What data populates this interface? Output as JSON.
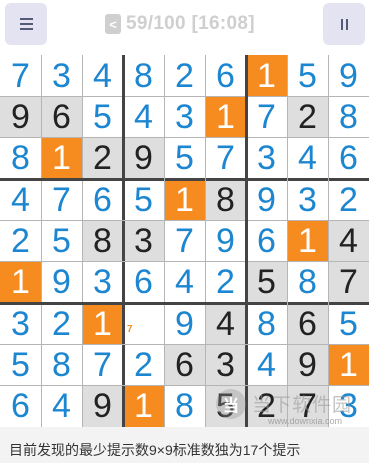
{
  "header": {
    "menu_icon": "hamburger-menu-icon",
    "back_label": "<",
    "progress_time": "59/100 [16:08]",
    "pause_icon": "pause-icon"
  },
  "colors": {
    "user_digit": "#1c86d0",
    "given_digit": "#222222",
    "given_background": "#dedede",
    "hint_background": "#f68b1f"
  },
  "board": {
    "size": 9,
    "cell_types": "u=user-entered (blue), g=given clue (grey cell), h=hint (orange cell), n=empty cell with pencil note",
    "rows": [
      [
        {
          "v": "7",
          "t": "u"
        },
        {
          "v": "3",
          "t": "u"
        },
        {
          "v": "4",
          "t": "u"
        },
        {
          "v": "8",
          "t": "u"
        },
        {
          "v": "2",
          "t": "u"
        },
        {
          "v": "6",
          "t": "u"
        },
        {
          "v": "1",
          "t": "h"
        },
        {
          "v": "5",
          "t": "u"
        },
        {
          "v": "9",
          "t": "u"
        }
      ],
      [
        {
          "v": "9",
          "t": "g"
        },
        {
          "v": "6",
          "t": "g"
        },
        {
          "v": "5",
          "t": "u"
        },
        {
          "v": "4",
          "t": "u"
        },
        {
          "v": "3",
          "t": "u"
        },
        {
          "v": "1",
          "t": "h"
        },
        {
          "v": "7",
          "t": "u"
        },
        {
          "v": "2",
          "t": "g"
        },
        {
          "v": "8",
          "t": "u"
        }
      ],
      [
        {
          "v": "8",
          "t": "u"
        },
        {
          "v": "1",
          "t": "h"
        },
        {
          "v": "2",
          "t": "g"
        },
        {
          "v": "9",
          "t": "g"
        },
        {
          "v": "5",
          "t": "u"
        },
        {
          "v": "7",
          "t": "u"
        },
        {
          "v": "3",
          "t": "u"
        },
        {
          "v": "4",
          "t": "u"
        },
        {
          "v": "6",
          "t": "u"
        }
      ],
      [
        {
          "v": "4",
          "t": "u"
        },
        {
          "v": "7",
          "t": "u"
        },
        {
          "v": "6",
          "t": "u"
        },
        {
          "v": "5",
          "t": "u"
        },
        {
          "v": "1",
          "t": "h"
        },
        {
          "v": "8",
          "t": "g"
        },
        {
          "v": "9",
          "t": "u"
        },
        {
          "v": "3",
          "t": "u"
        },
        {
          "v": "2",
          "t": "u"
        }
      ],
      [
        {
          "v": "2",
          "t": "u"
        },
        {
          "v": "5",
          "t": "u"
        },
        {
          "v": "8",
          "t": "g"
        },
        {
          "v": "3",
          "t": "g"
        },
        {
          "v": "7",
          "t": "u"
        },
        {
          "v": "9",
          "t": "u"
        },
        {
          "v": "6",
          "t": "u"
        },
        {
          "v": "1",
          "t": "h"
        },
        {
          "v": "4",
          "t": "g"
        }
      ],
      [
        {
          "v": "1",
          "t": "h"
        },
        {
          "v": "9",
          "t": "u"
        },
        {
          "v": "3",
          "t": "u"
        },
        {
          "v": "6",
          "t": "u"
        },
        {
          "v": "4",
          "t": "u"
        },
        {
          "v": "2",
          "t": "u"
        },
        {
          "v": "5",
          "t": "g"
        },
        {
          "v": "8",
          "t": "u"
        },
        {
          "v": "7",
          "t": "g"
        }
      ],
      [
        {
          "v": "3",
          "t": "u"
        },
        {
          "v": "2",
          "t": "u"
        },
        {
          "v": "1",
          "t": "h"
        },
        {
          "v": "7",
          "t": "n"
        },
        {
          "v": "9",
          "t": "u"
        },
        {
          "v": "4",
          "t": "g"
        },
        {
          "v": "8",
          "t": "u"
        },
        {
          "v": "6",
          "t": "g"
        },
        {
          "v": "5",
          "t": "u"
        }
      ],
      [
        {
          "v": "5",
          "t": "u"
        },
        {
          "v": "8",
          "t": "u"
        },
        {
          "v": "7",
          "t": "u"
        },
        {
          "v": "2",
          "t": "u"
        },
        {
          "v": "6",
          "t": "g"
        },
        {
          "v": "3",
          "t": "g"
        },
        {
          "v": "4",
          "t": "u"
        },
        {
          "v": "9",
          "t": "g"
        },
        {
          "v": "1",
          "t": "h"
        }
      ],
      [
        {
          "v": "6",
          "t": "u"
        },
        {
          "v": "4",
          "t": "u"
        },
        {
          "v": "9",
          "t": "g"
        },
        {
          "v": "1",
          "t": "h"
        },
        {
          "v": "8",
          "t": "u"
        },
        {
          "v": "5",
          "t": "g"
        },
        {
          "v": "2",
          "t": "g"
        },
        {
          "v": "7",
          "t": "g"
        },
        {
          "v": "3",
          "t": "u"
        }
      ]
    ]
  },
  "footer": {
    "caption": "目前发现的最少提示数9×9标准数独为17个提示"
  },
  "watermark": {
    "logo_text": "当",
    "name": "当下软件园",
    "url": "www.downxia.com"
  }
}
